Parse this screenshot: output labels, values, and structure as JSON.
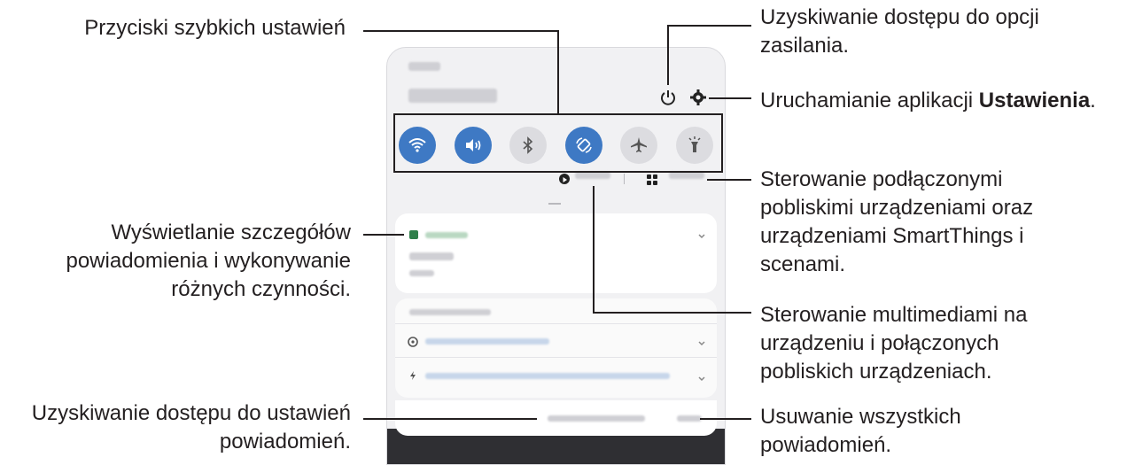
{
  "callouts": {
    "quick_settings": "Przyciski szybkich ustawień",
    "power_line1": "Uzyskiwanie dostępu do opcji",
    "power_line2": "zasilania.",
    "settings_prefix": "Uruchamianie aplikacji ",
    "settings_bold": "Ustawienia",
    "settings_suffix": ".",
    "devices_line1": "Sterowanie podłączonymi",
    "devices_line2": "pobliskimi urządzeniami oraz",
    "devices_line3": "urządzeniami SmartThings i",
    "devices_line4": "scenami.",
    "notif_line1": "Wyświetlanie szczegółów",
    "notif_line2": "powiadomienia i wykonywanie",
    "notif_line3": "różnych czynności.",
    "media_line1": "Sterowanie multimediami na",
    "media_line2": "urządzeniu i połączonych",
    "media_line3": "pobliskich urządzeniach.",
    "notif_settings_line1": "Uzyskiwanie dostępu do ustawień",
    "notif_settings_line2": "powiadomień.",
    "clear_line1": "Usuwanie wszystkich",
    "clear_line2": "powiadomień."
  },
  "quick_settings": [
    {
      "icon": "wifi-icon",
      "on": true
    },
    {
      "icon": "sound-icon",
      "on": true
    },
    {
      "icon": "bluetooth-icon",
      "on": false
    },
    {
      "icon": "auto-rotate-icon",
      "on": true
    },
    {
      "icon": "airplane-icon",
      "on": false
    },
    {
      "icon": "flashlight-icon",
      "on": false
    }
  ],
  "colors": {
    "accent": "#3e79c4",
    "inactive": "#dcdce0",
    "panel": "#f1f1f3"
  }
}
